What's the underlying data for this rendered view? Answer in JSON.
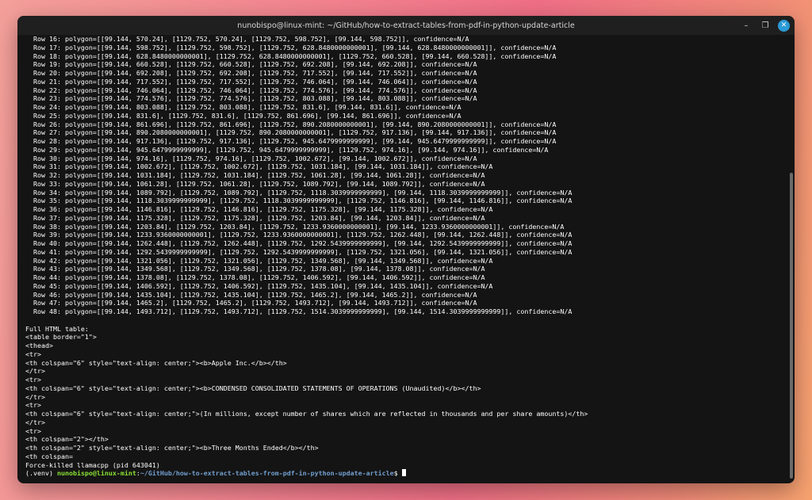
{
  "window": {
    "title": "nunobispo@linux-mint: ~/GitHub/how-to-extract-tables-from-pdf-in-python-update-article",
    "minimize_icon": "minimize-icon",
    "maximize_icon": "maximize-icon",
    "close_icon": "close-icon"
  },
  "terminal": {
    "lines": [
      "  Row 16: polygon=[[99.144, 570.24], [1129.752, 570.24], [1129.752, 598.752], [99.144, 598.752]], confidence=N/A",
      "  Row 17: polygon=[[99.144, 598.752], [1129.752, 598.752], [1129.752, 628.8480000000001], [99.144, 628.8480000000001]], confidence=N/A",
      "  Row 18: polygon=[[99.144, 628.8480000000001], [1129.752, 628.8480000000001], [1129.752, 660.528], [99.144, 660.528]], confidence=N/A",
      "  Row 19: polygon=[[99.144, 660.528], [1129.752, 660.528], [1129.752, 692.208], [99.144, 692.208]], confidence=N/A",
      "  Row 20: polygon=[[99.144, 692.208], [1129.752, 692.208], [1129.752, 717.552], [99.144, 717.552]], confidence=N/A",
      "  Row 21: polygon=[[99.144, 717.552], [1129.752, 717.552], [1129.752, 746.064], [99.144, 746.064]], confidence=N/A",
      "  Row 22: polygon=[[99.144, 746.064], [1129.752, 746.064], [1129.752, 774.576], [99.144, 774.576]], confidence=N/A",
      "  Row 23: polygon=[[99.144, 774.576], [1129.752, 774.576], [1129.752, 803.088], [99.144, 803.088]], confidence=N/A",
      "  Row 24: polygon=[[99.144, 803.088], [1129.752, 803.088], [1129.752, 831.6], [99.144, 831.6]], confidence=N/A",
      "  Row 25: polygon=[[99.144, 831.6], [1129.752, 831.6], [1129.752, 861.696], [99.144, 861.696]], confidence=N/A",
      "  Row 26: polygon=[[99.144, 861.696], [1129.752, 861.696], [1129.752, 890.2080000000001], [99.144, 890.2080000000001]], confidence=N/A",
      "  Row 27: polygon=[[99.144, 890.2080000000001], [1129.752, 890.2080000000001], [1129.752, 917.136], [99.144, 917.136]], confidence=N/A",
      "  Row 28: polygon=[[99.144, 917.136], [1129.752, 917.136], [1129.752, 945.6479999999999], [99.144, 945.6479999999999]], confidence=N/A",
      "  Row 29: polygon=[[99.144, 945.6479999999999], [1129.752, 945.6479999999999], [1129.752, 974.16], [99.144, 974.16]], confidence=N/A",
      "  Row 30: polygon=[[99.144, 974.16], [1129.752, 974.16], [1129.752, 1002.672], [99.144, 1002.672]], confidence=N/A",
      "  Row 31: polygon=[[99.144, 1002.672], [1129.752, 1002.672], [1129.752, 1031.184], [99.144, 1031.184]], confidence=N/A",
      "  Row 32: polygon=[[99.144, 1031.184], [1129.752, 1031.184], [1129.752, 1061.28], [99.144, 1061.28]], confidence=N/A",
      "  Row 33: polygon=[[99.144, 1061.28], [1129.752, 1061.28], [1129.752, 1089.792], [99.144, 1089.792]], confidence=N/A",
      "  Row 34: polygon=[[99.144, 1089.792], [1129.752, 1089.792], [1129.752, 1118.3039999999999], [99.144, 1118.3039999999999]], confidence=N/A",
      "  Row 35: polygon=[[99.144, 1118.3039999999999], [1129.752, 1118.3039999999999], [1129.752, 1146.816], [99.144, 1146.816]], confidence=N/A",
      "  Row 36: polygon=[[99.144, 1146.816], [1129.752, 1146.816], [1129.752, 1175.328], [99.144, 1175.328]], confidence=N/A",
      "  Row 37: polygon=[[99.144, 1175.328], [1129.752, 1175.328], [1129.752, 1203.84], [99.144, 1203.84]], confidence=N/A",
      "  Row 38: polygon=[[99.144, 1203.84], [1129.752, 1203.84], [1129.752, 1233.9360000000001], [99.144, 1233.9360000000001]], confidence=N/A",
      "  Row 39: polygon=[[99.144, 1233.9360000000001], [1129.752, 1233.9360000000001], [1129.752, 1262.448], [99.144, 1262.448]], confidence=N/A",
      "  Row 40: polygon=[[99.144, 1262.448], [1129.752, 1262.448], [1129.752, 1292.5439999999999], [99.144, 1292.5439999999999]], confidence=N/A",
      "  Row 41: polygon=[[99.144, 1292.5439999999999], [1129.752, 1292.5439999999999], [1129.752, 1321.056], [99.144, 1321.056]], confidence=N/A",
      "  Row 42: polygon=[[99.144, 1321.056], [1129.752, 1321.056], [1129.752, 1349.568], [99.144, 1349.568]], confidence=N/A",
      "  Row 43: polygon=[[99.144, 1349.568], [1129.752, 1349.568], [1129.752, 1378.08], [99.144, 1378.08]], confidence=N/A",
      "  Row 44: polygon=[[99.144, 1378.08], [1129.752, 1378.08], [1129.752, 1406.592], [99.144, 1406.592]], confidence=N/A",
      "  Row 45: polygon=[[99.144, 1406.592], [1129.752, 1406.592], [1129.752, 1435.104], [99.144, 1435.104]], confidence=N/A",
      "  Row 46: polygon=[[99.144, 1435.104], [1129.752, 1435.104], [1129.752, 1465.2], [99.144, 1465.2]], confidence=N/A",
      "  Row 47: polygon=[[99.144, 1465.2], [1129.752, 1465.2], [1129.752, 1493.712], [99.144, 1493.712]], confidence=N/A",
      "  Row 48: polygon=[[99.144, 1493.712], [1129.752, 1493.712], [1129.752, 1514.3039999999999], [99.144, 1514.3039999999999]], confidence=N/A",
      "",
      "Full HTML table:",
      "<table border=\"1\">",
      "<thead>",
      "<tr>",
      "<th colspan=\"6\" style=\"text-align: center;\"><b>Apple Inc.</b></th>",
      "</tr>",
      "<tr>",
      "<th colspan=\"6\" style=\"text-align: center;\"><b>CONDENSED CONSOLIDATED STATEMENTS OF OPERATIONS (Unaudited)</b></th>",
      "</tr>",
      "<tr>",
      "<th colspan=\"6\" style=\"text-align: center;\">(In millions, except number of shares which are reflected in thousands and per share amounts)</th>",
      "</tr>",
      "<tr>",
      "<th colspan=\"2\"></th>",
      "<th colspan=\"2\" style=\"text-align: center;\"><b>Three Months Ended</b></th>",
      "<th colspan=",
      "Force-killed llamacpp (pid 643041)"
    ],
    "prompt": {
      "venv": "(.venv) ",
      "user_host": "nunobispo@linux-mint",
      "sep": ":",
      "path": "~/GitHub/how-to-extract-tables-from-pdf-in-python-update-article",
      "symbol": "$ "
    }
  }
}
